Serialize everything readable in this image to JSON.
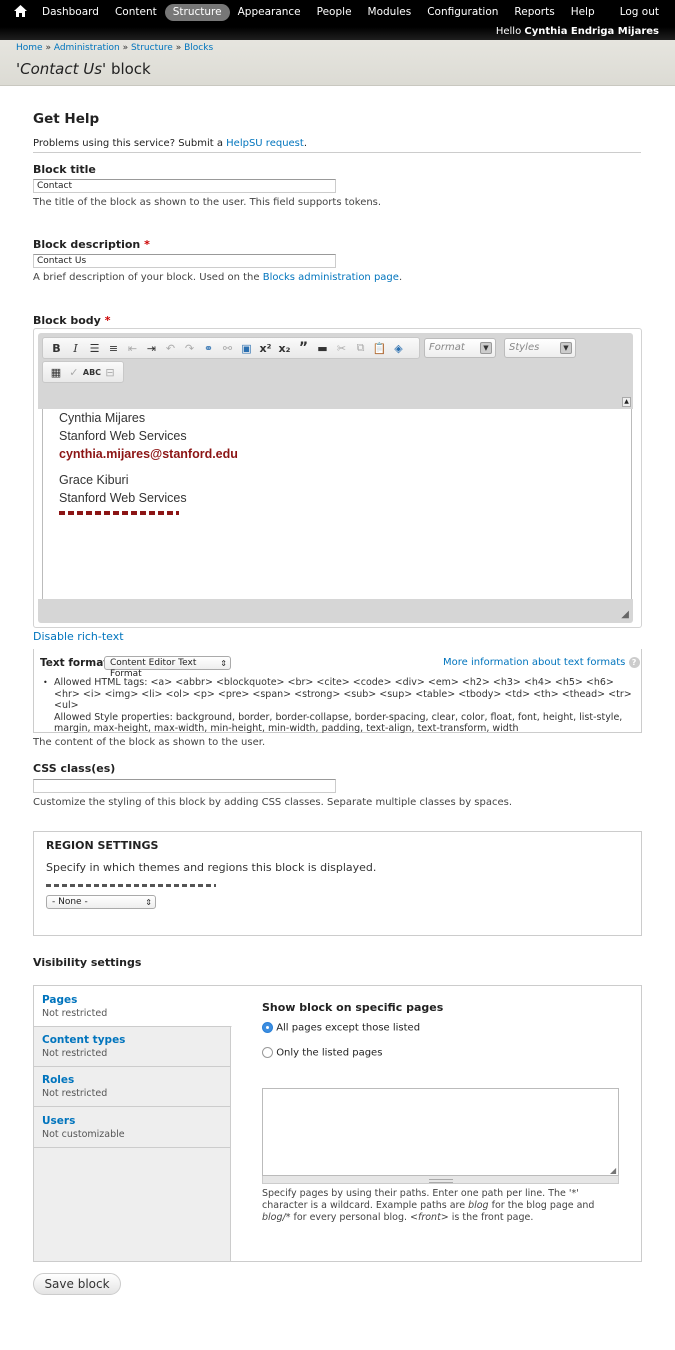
{
  "toolbar": {
    "home_icon": "home-icon",
    "menu": [
      "Dashboard",
      "Content",
      "Structure",
      "Appearance",
      "People",
      "Modules",
      "Configuration",
      "Reports",
      "Help"
    ],
    "active": "Structure",
    "logout": "Log out",
    "hello_prefix": "Hello",
    "user_name": "Cynthia Endriga Mijares"
  },
  "breadcrumb": [
    "Home",
    "Administration",
    "Structure",
    "Blocks"
  ],
  "breadcrumb_sep": "»",
  "page_title": {
    "quote_open": "'",
    "name": "Contact Us",
    "quote_close": "'",
    "suffix": " block"
  },
  "get_help": {
    "heading": "Get Help",
    "text_before": "Problems using this service? Submit a ",
    "link": "HelpSU request",
    "text_after": "."
  },
  "block_title": {
    "label": "Block title",
    "value": "Contact",
    "description": "The title of the block as shown to the user. This field supports tokens."
  },
  "block_description": {
    "label": "Block description",
    "required": "*",
    "value": "Contact Us",
    "description_before": "A brief description of your block. Used on the ",
    "description_link": "Blocks administration page",
    "description_after": "."
  },
  "block_body": {
    "label": "Block body",
    "required": "*",
    "toolbar_buttons": [
      "B",
      "I",
      "bulleted-list-icon",
      "numbered-list-icon",
      "outdent-icon",
      "indent-icon",
      "undo-icon",
      "redo-icon",
      "link-icon",
      "unlink-icon",
      "image-icon",
      "x²",
      "x₂",
      "”",
      "horizontal-rule-icon",
      "cut-icon",
      "copy-icon",
      "paste-icon",
      "remove-format-icon",
      "table-icon",
      "spellcheck-icon",
      "abc-icon",
      "show-blocks-icon"
    ],
    "format_combo": "Format",
    "styles_combo": "Styles",
    "content": [
      {
        "text": "Cynthia Mijares",
        "type": "plain"
      },
      {
        "text": "Stanford Web Services",
        "type": "plain"
      },
      {
        "text": "cynthia.mijares@stanford.edu",
        "type": "email"
      },
      {
        "text": "Grace Kiburi",
        "type": "plain"
      },
      {
        "text": "Stanford Web Services",
        "type": "plain"
      }
    ],
    "disable_rich_text": "Disable rich-text",
    "text_format_label": "Text format",
    "text_format_value": "Content Editor Text Format",
    "more_info": "More information about text formats",
    "allowed_tags": "Allowed HTML tags: <a> <abbr> <blockquote> <br> <cite> <code> <div> <em> <h2> <h3> <h4> <h5> <h6> <hr> <i> <img> <li> <ol> <p> <pre> <span> <strong> <sub> <sup> <table> <tbody> <td> <th> <thead> <tr> <ul>",
    "allowed_styles": "Allowed Style properties: background, border, border-collapse, border-spacing, clear, color, float, font, height, list-style, margin, max-height, max-width, min-height, min-width, padding, text-align, text-transform, width",
    "description": "The content of the block as shown to the user."
  },
  "css_class": {
    "label": "CSS class(es)",
    "value": "",
    "description": "Customize the styling of this block by adding CSS classes. Separate multiple classes by spaces."
  },
  "region": {
    "heading": "REGION SETTINGS",
    "description": "Specify in which themes and regions this block is displayed.",
    "select_value": "- None -"
  },
  "visibility": {
    "heading": "Visibility settings",
    "tabs": [
      {
        "title": "Pages",
        "summary": "Not restricted"
      },
      {
        "title": "Content types",
        "summary": "Not restricted"
      },
      {
        "title": "Roles",
        "summary": "Not restricted"
      },
      {
        "title": "Users",
        "summary": "Not customizable"
      }
    ],
    "pane_heading": "Show block on specific pages",
    "options": [
      "All pages except those listed",
      "Only the listed pages"
    ],
    "selected_option": 0,
    "pages_value": "",
    "help": {
      "p1": "Specify pages by using their paths. Enter one path per line. The '*' character is a wildcard. Example paths are ",
      "blog": "blog",
      "p2": " for the blog page and ",
      "blog_star": "blog/*",
      "p3": " for every personal blog. ",
      "front": "<front>",
      "p4": " is the front page."
    }
  },
  "save_button": "Save block"
}
